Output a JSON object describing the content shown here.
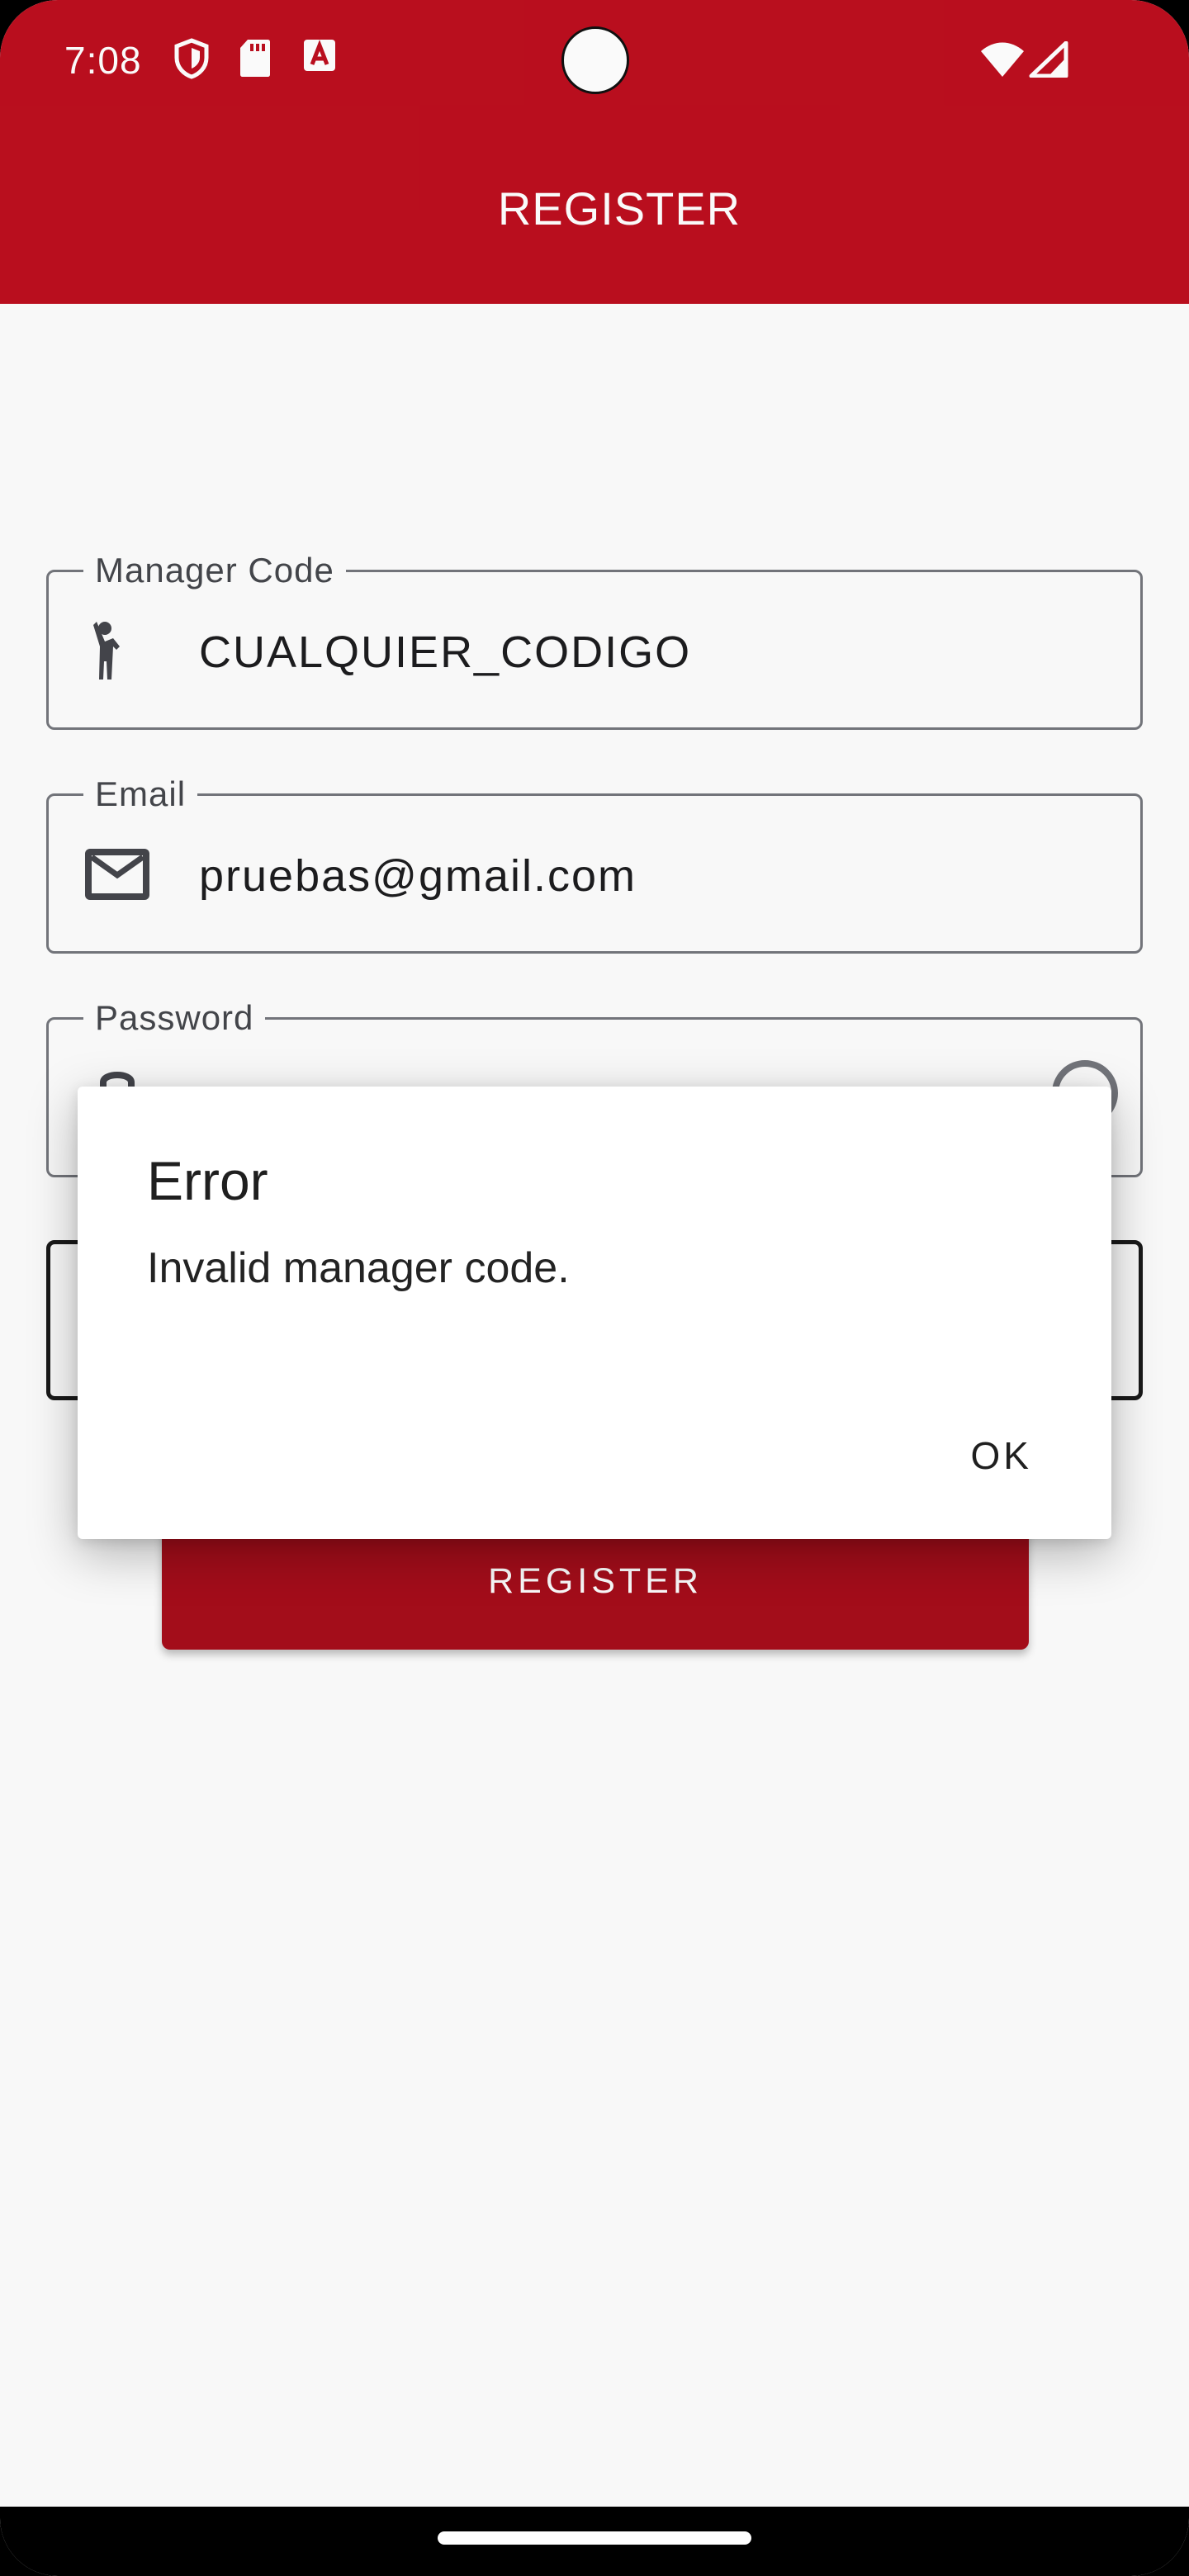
{
  "status_bar": {
    "time": "7:08",
    "icons_left": [
      "shield-icon",
      "sd-card-icon",
      "font-a-icon"
    ],
    "icons_right": [
      "wifi-icon",
      "cellular-signal-icon"
    ]
  },
  "app_bar": {
    "title": "REGISTER",
    "color": "#bd0f1f"
  },
  "form": {
    "manager_code": {
      "label": "Manager Code",
      "value": "CUALQUIER_CODIGO",
      "icon": "person-waving-icon"
    },
    "email": {
      "label": "Email",
      "value": "pruebas@gmail.com",
      "icon": "mail-icon"
    },
    "password": {
      "label": "Password"
    },
    "register_button": {
      "label": "REGISTER"
    }
  },
  "dialog": {
    "title": "Error",
    "message": "Invalid manager code.",
    "ok_label": "OK"
  }
}
